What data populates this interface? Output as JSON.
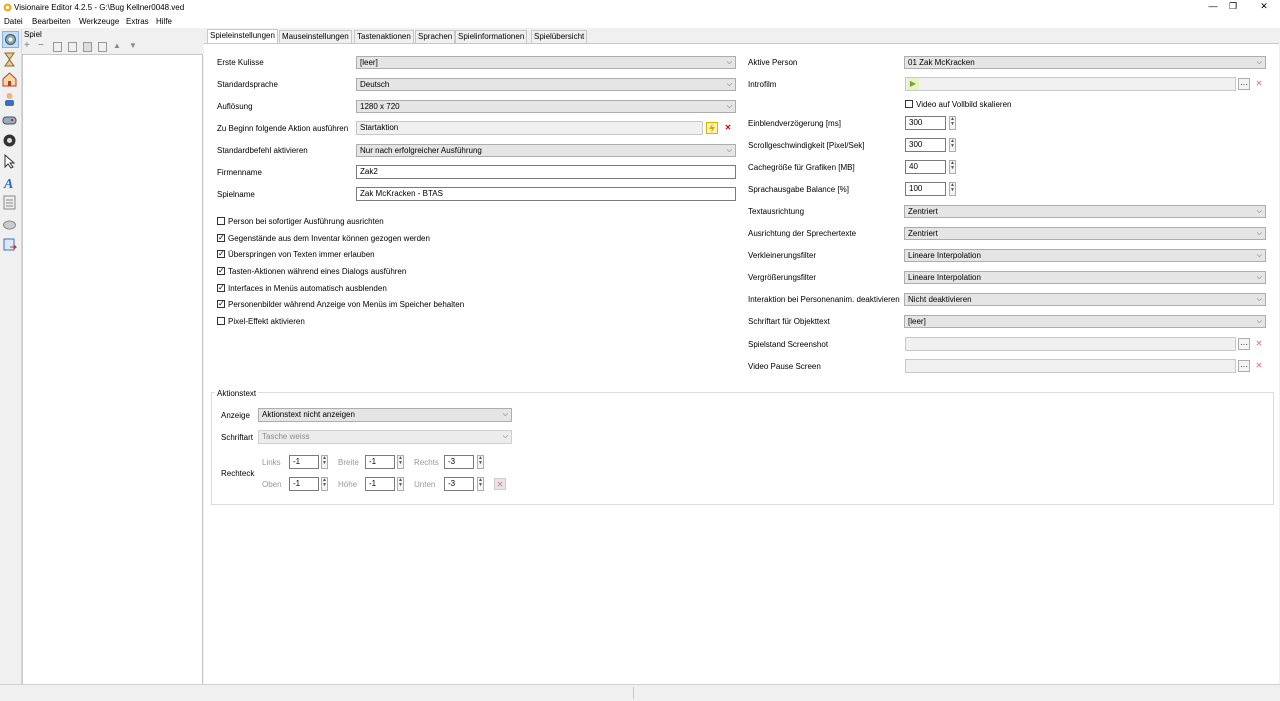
{
  "window": {
    "title": "Visionaire Editor 4.2.5 - G:\\Bug Kellner0048.ved",
    "minimize": "—",
    "restore": "❐",
    "close": "✕"
  },
  "menu": [
    "Datei",
    "Bearbeiten",
    "Werkzeuge",
    "Extras",
    "Hilfe"
  ],
  "tree": {
    "header": "Spiel"
  },
  "tabs": [
    "Spieleinstellungen",
    "Mauseinstellungen",
    "Tastenaktionen",
    "Sprachen",
    "Spielinformationen",
    "Spielübersicht"
  ],
  "left": {
    "erste_kulisse": {
      "label": "Erste Kulisse",
      "value": "[leer]"
    },
    "standardsprache": {
      "label": "Standardsprache",
      "value": "Deutsch"
    },
    "aufloesung": {
      "label": "Auflösung",
      "value": "1280 x 720"
    },
    "beginn_aktion": {
      "label": "Zu Beginn folgende Aktion ausführen",
      "value": "Startaktion"
    },
    "standardbefehl": {
      "label": "Standardbefehl aktivieren",
      "value": "Nur nach erfolgreicher Ausführung"
    },
    "firmenname": {
      "label": "Firmenname",
      "value": "Zak2"
    },
    "spielname": {
      "label": "Spielname",
      "value": "Zak McKracken - BTAS"
    }
  },
  "checkboxes": [
    {
      "label": "Person bei sofortiger Ausführung ausrichten",
      "checked": false
    },
    {
      "label": "Gegenstände aus dem Inventar können gezogen werden",
      "checked": true
    },
    {
      "label": "Überspringen von Texten immer erlauben",
      "checked": true
    },
    {
      "label": "Tasten-Aktionen während eines Dialogs ausführen",
      "checked": true
    },
    {
      "label": "Interfaces in Menüs automatisch ausblenden",
      "checked": true
    },
    {
      "label": "Personenbilder während Anzeige von Menüs im Speicher behalten",
      "checked": true
    },
    {
      "label": "Pixel-Effekt aktivieren",
      "checked": false
    }
  ],
  "right": {
    "aktive_person": {
      "label": "Aktive Person",
      "value": "01 Zak McKracken"
    },
    "introfilm": {
      "label": "Introfilm",
      "value": ""
    },
    "video_vollbild": {
      "label": "Video auf Vollbild skalieren",
      "checked": false
    },
    "einblend": {
      "label": "Einblendverzögerung [ms]",
      "value": "300"
    },
    "scroll": {
      "label": "Scrollgeschwindigkeit [Pixel/Sek]",
      "value": "300"
    },
    "cache": {
      "label": "Cachegröße für Grafiken [MB]",
      "value": "40"
    },
    "balance": {
      "label": "Sprachausgabe Balance [%]",
      "value": "100"
    },
    "textausrichtung": {
      "label": "Textausrichtung",
      "value": "Zentriert"
    },
    "sprechertexte": {
      "label": "Ausrichtung der Sprechertexte",
      "value": "Zentriert"
    },
    "verkleinerung": {
      "label": "Verkleinerungsfilter",
      "value": "Lineare Interpolation"
    },
    "vergroesserung": {
      "label": "Vergrößerungsfilter",
      "value": "Lineare Interpolation"
    },
    "interaktion": {
      "label": "Interaktion bei Personenanim. deaktivieren",
      "value": "Nicht deaktivieren"
    },
    "schriftart_obj": {
      "label": "Schriftart für Objekttext",
      "value": "[leer]"
    },
    "screenshot": {
      "label": "Spielstand Screenshot",
      "value": ""
    },
    "pause": {
      "label": "Video Pause Screen",
      "value": ""
    }
  },
  "aktionstext": {
    "title": "Aktionstext",
    "anzeige": {
      "label": "Anzeige",
      "value": "Aktionstext nicht anzeigen"
    },
    "schriftart": {
      "label": "Schriftart",
      "value": "Tasche weiss"
    },
    "rechteck": {
      "label": "Rechteck",
      "links": {
        "label": "Links",
        "value": "-1"
      },
      "breite": {
        "label": "Breite",
        "value": "-1"
      },
      "rechts": {
        "label": "Rechts",
        "value": "-3"
      },
      "oben": {
        "label": "Oben",
        "value": "-1"
      },
      "hoehe": {
        "label": "Höhe",
        "value": "-1"
      },
      "unten": {
        "label": "Unten",
        "value": "-3"
      }
    }
  },
  "glyphs": {
    "dropdown": "⌵",
    "dots": "···",
    "x": "✕",
    "up": "▲",
    "down": "▼",
    "play": "▶",
    "check": "✓"
  },
  "icons": [
    "app-icon",
    "gear-icon",
    "hourglass-icon",
    "home-icon",
    "person-icon",
    "gamepad-icon",
    "disc-icon",
    "cursor-icon",
    "font-icon",
    "list-icon",
    "cloud-icon",
    "export-icon"
  ]
}
